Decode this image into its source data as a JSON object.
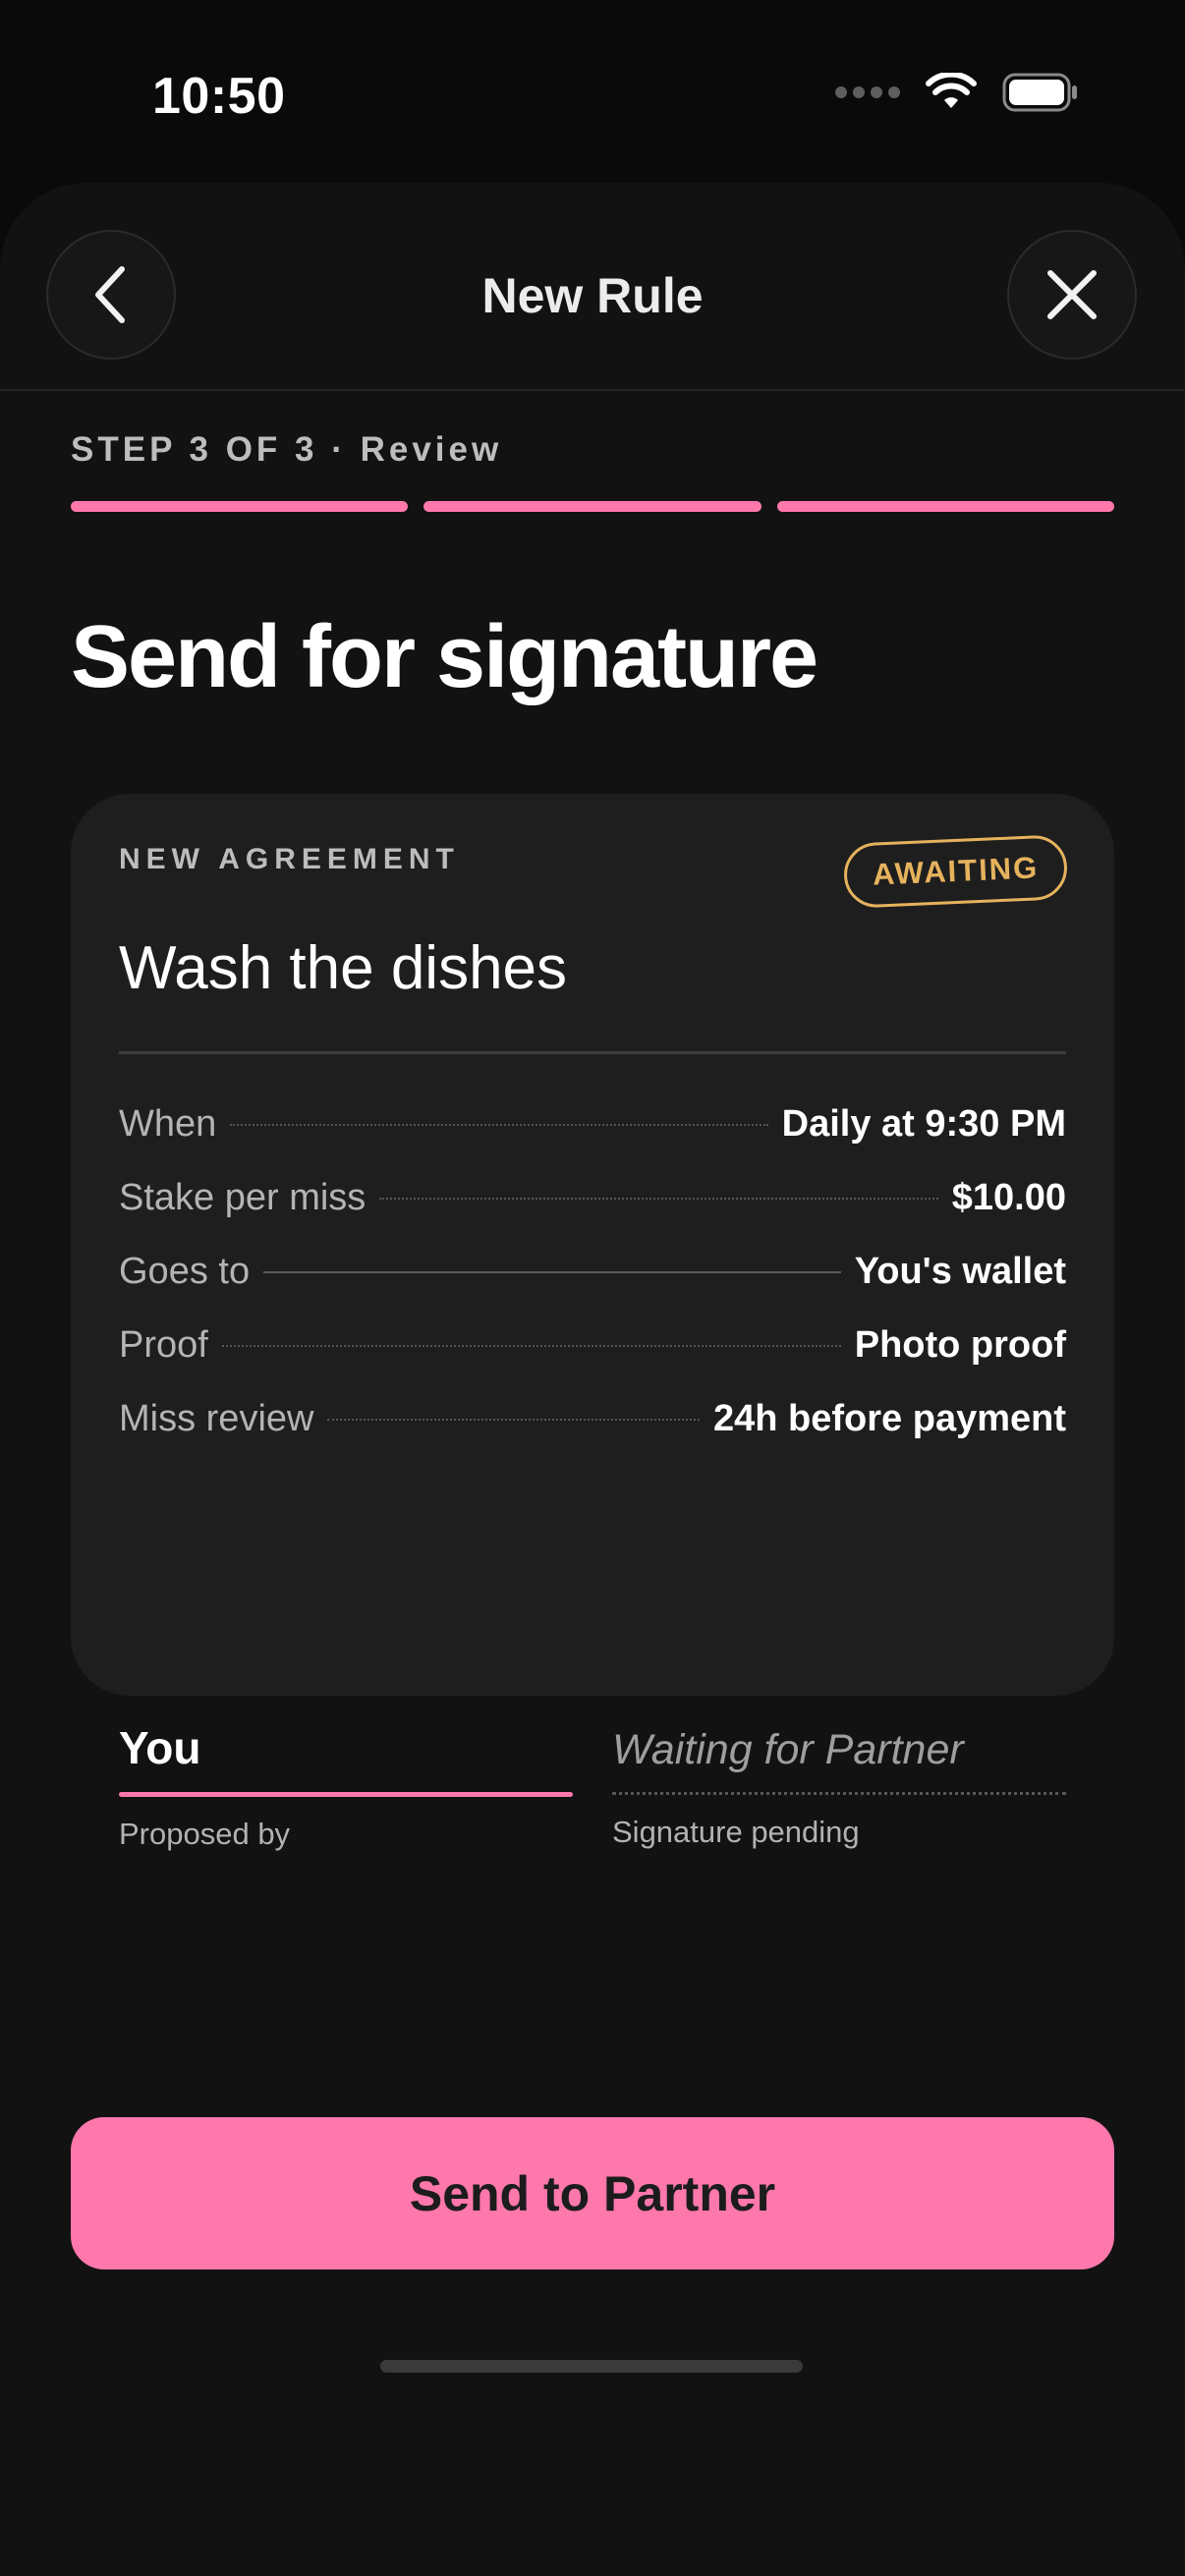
{
  "status_bar": {
    "time": "10:50"
  },
  "header": {
    "title": "New Rule",
    "back_icon": "chevron-left-icon",
    "close_icon": "close-icon"
  },
  "step": {
    "label": "STEP 3 OF 3 · Review",
    "total": 3,
    "completed": 3
  },
  "page_title": "Send for signature",
  "card": {
    "eyebrow": "NEW AGREEMENT",
    "badge": "AWAITING",
    "title": "Wash the dishes",
    "rows": [
      {
        "label": "When",
        "value": "Daily at 9:30 PM"
      },
      {
        "label": "Stake per miss",
        "value": "$10.00"
      },
      {
        "label": "Goes to",
        "value": "You's wallet"
      },
      {
        "label": "Proof",
        "value": "Photo proof"
      },
      {
        "label": "Miss review",
        "value": "24h before payment"
      }
    ],
    "signatures": {
      "left": {
        "name": "You",
        "caption": "Proposed by"
      },
      "right": {
        "name": "Waiting for Partner",
        "caption": "Signature pending"
      }
    }
  },
  "cta": {
    "label": "Send to Partner"
  },
  "colors": {
    "accent": "#ff78ac",
    "badge": "#e6b25d",
    "background": "#0a0a0a",
    "card": "#1e1e1e"
  }
}
